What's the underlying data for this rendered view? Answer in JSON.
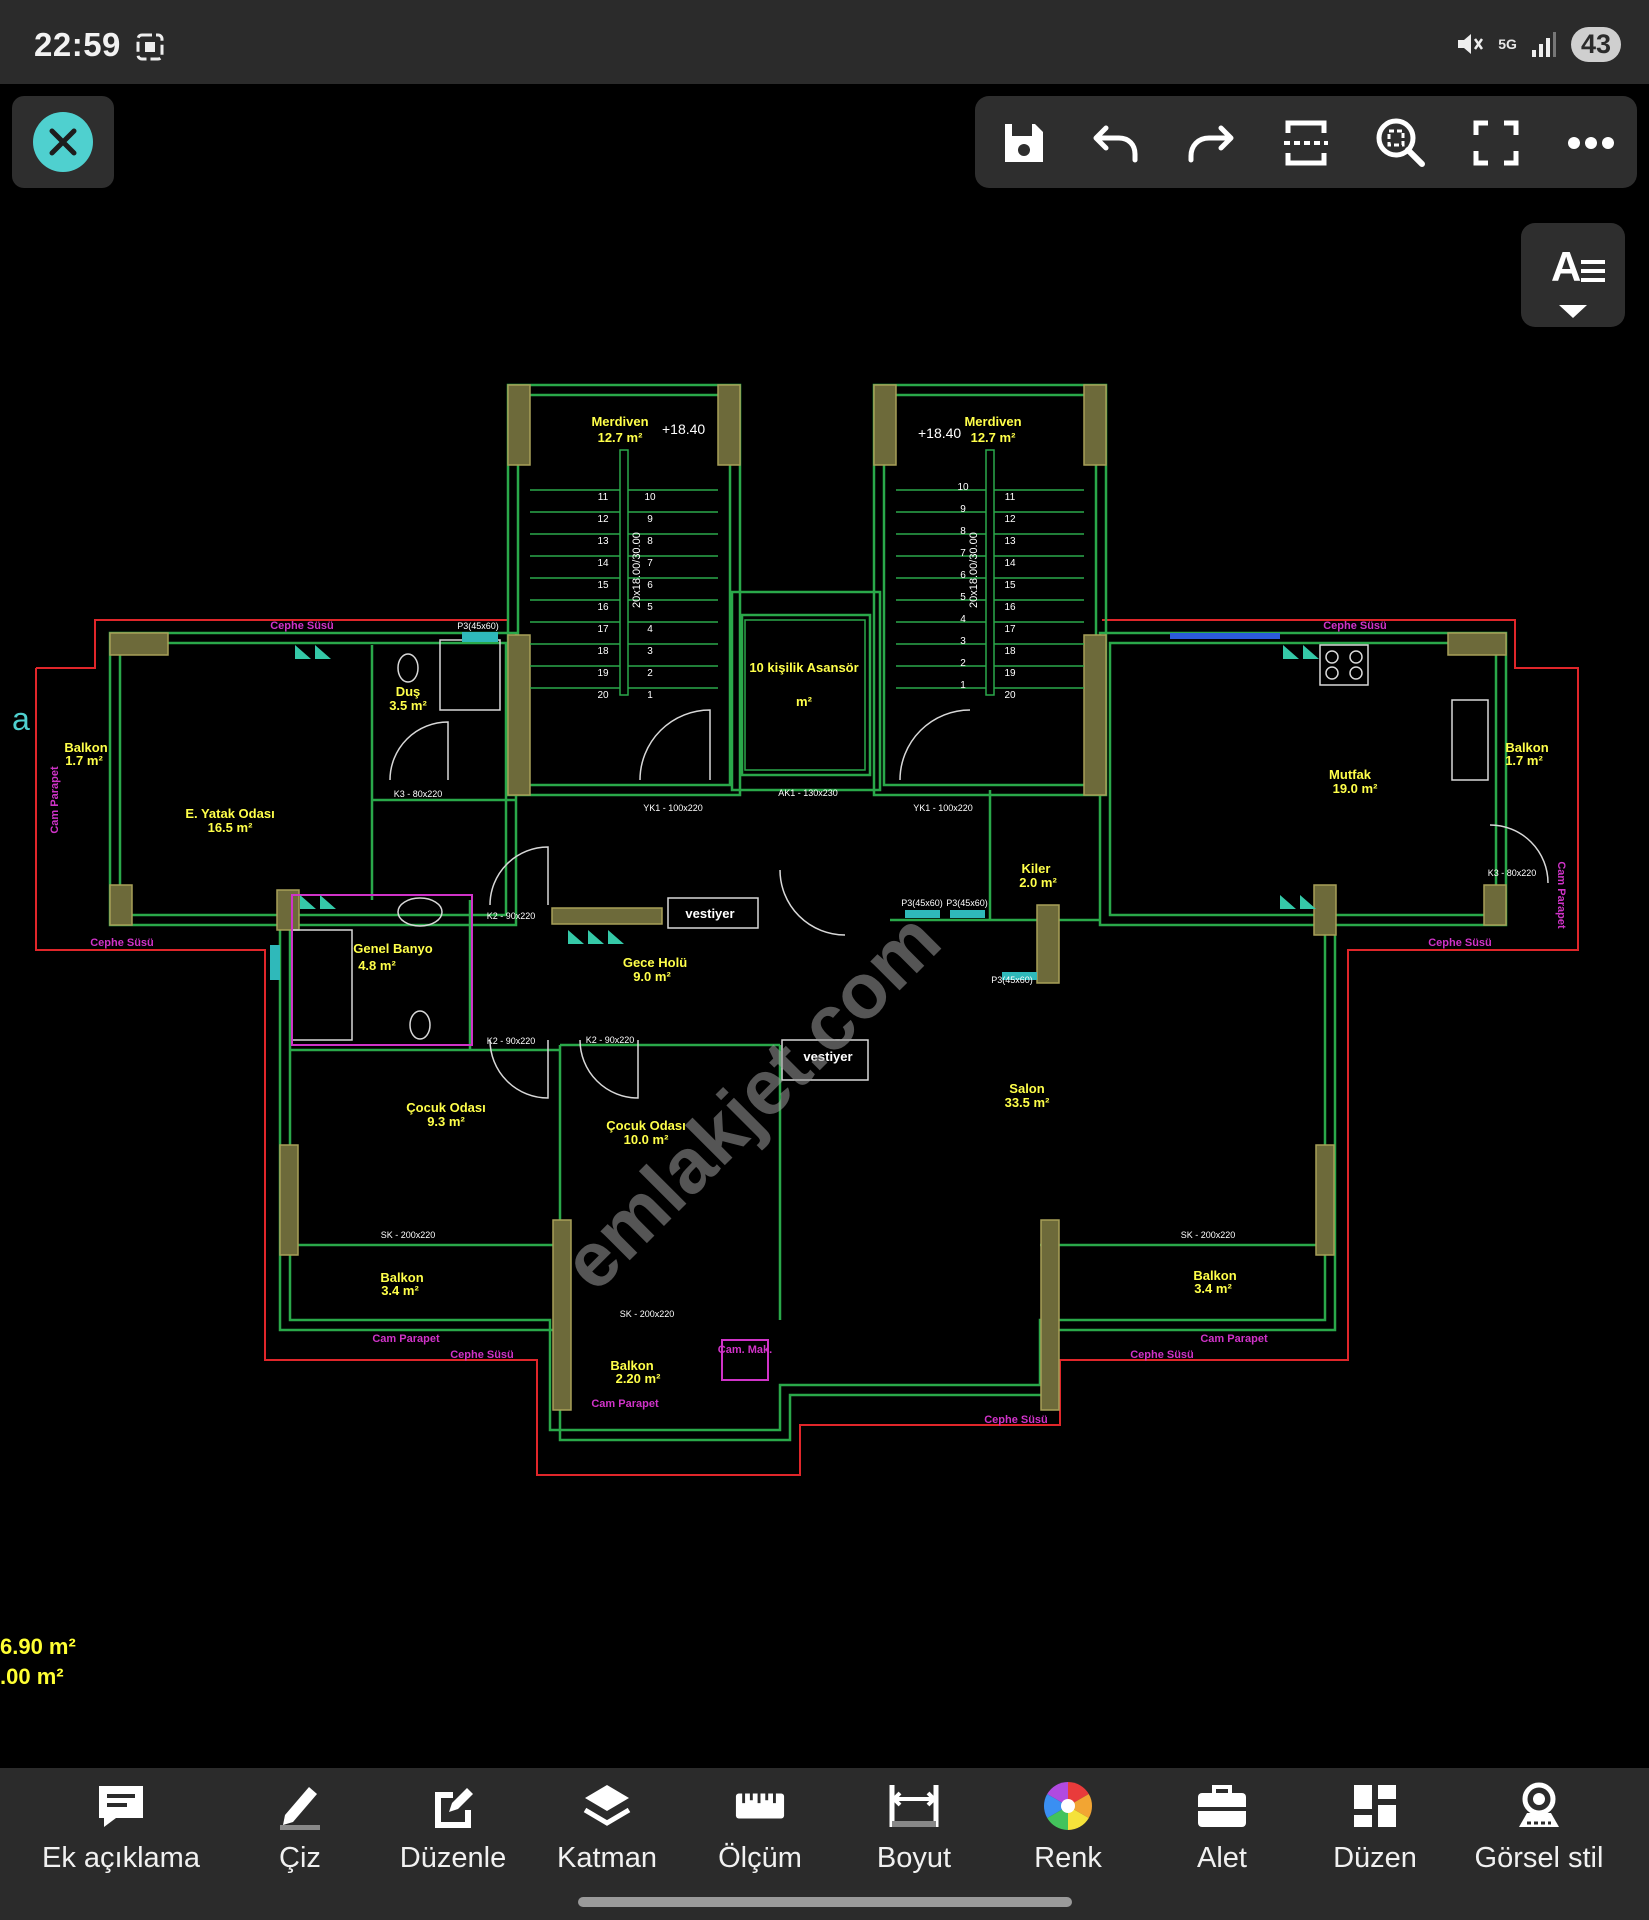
{
  "status": {
    "time": "22:59",
    "network": "5G",
    "battery": "43"
  },
  "toolbar": {
    "close": "close-icon",
    "buttons": [
      "save-icon",
      "undo-icon",
      "redo-icon",
      "fit-extents-icon",
      "zoom-window-icon",
      "fullscreen-icon",
      "more-icon"
    ]
  },
  "text_style": {
    "glyph": "A"
  },
  "plan": {
    "left_mark": "a",
    "elevation_left": "+18.40",
    "elevation_right": "+18.40",
    "rooms": [
      {
        "name": "Merdiven",
        "area": "12.7 m²"
      },
      {
        "name": "Merdiven",
        "area": "12.7 m²"
      },
      {
        "name": "10 kişilik Asansör",
        "area": "m²"
      },
      {
        "name": "Duş",
        "area": "3.5 m²"
      },
      {
        "name": "Balkon",
        "area": "1.7 m²"
      },
      {
        "name": "E. Yatak Odası",
        "area": "16.5 m²"
      },
      {
        "name": "Genel Banyo",
        "area": "4.8 m²"
      },
      {
        "name": "Gece Holü",
        "area": "9.0 m²"
      },
      {
        "name": "Çocuk Odası",
        "area": "9.3 m²"
      },
      {
        "name": "Çocuk Odası",
        "area": "10.0 m²"
      },
      {
        "name": "Salon",
        "area": "33.5 m²"
      },
      {
        "name": "Mutfak",
        "area": "19.0 m²"
      },
      {
        "name": "Kiler",
        "area": "2.0 m²"
      },
      {
        "name": "Balkon",
        "area": "1.7 m²"
      },
      {
        "name": "Balkon",
        "area": "3.4 m²"
      },
      {
        "name": "Balkon",
        "area": "2.20 m²"
      },
      {
        "name": "Balkon",
        "area": "3.4 m²"
      }
    ],
    "labels": {
      "cephe": "Cephe Süsü",
      "cam_parapet": "Cam Parapet",
      "vestiyer": "vestiyer",
      "cam_mak": "Cam. Mak.",
      "door_k3": "K3 - 80x220",
      "door_k2": "K2 - 90x220",
      "door_ak1": "AK1 - 130x230",
      "window_sk": "SK - 200x220",
      "fire_door": "YK1 - 100x220",
      "stair_dim": "20x18.00/30.00",
      "window_p3": "P3(45x60)"
    },
    "stair_numbers_left": [
      "11",
      "12",
      "13",
      "14",
      "15",
      "16",
      "17",
      "18",
      "19",
      "20"
    ],
    "stair_numbers_mid": [
      "10",
      "9",
      "8",
      "7",
      "6",
      "5",
      "4",
      "3",
      "2",
      "1"
    ],
    "watermark": "emlakjet.com"
  },
  "area_readout": {
    "line1": "6.90 m²",
    "line2": ".00 m²"
  },
  "bottom_bar": {
    "items": [
      {
        "label": "Ek açıklama",
        "icon": "comment-icon"
      },
      {
        "label": "Çiz",
        "icon": "pencil-icon"
      },
      {
        "label": "Düzenle",
        "icon": "edit-icon"
      },
      {
        "label": "Katman",
        "icon": "layers-icon"
      },
      {
        "label": "Ölçüm",
        "icon": "ruler-icon"
      },
      {
        "label": "Boyut",
        "icon": "dimension-icon"
      },
      {
        "label": "Renk",
        "icon": "color-wheel-icon"
      },
      {
        "label": "Alet",
        "icon": "toolbox-icon"
      },
      {
        "label": "Düzen",
        "icon": "layout-icon"
      },
      {
        "label": "Görsel stil",
        "icon": "visual-style-icon"
      }
    ]
  }
}
